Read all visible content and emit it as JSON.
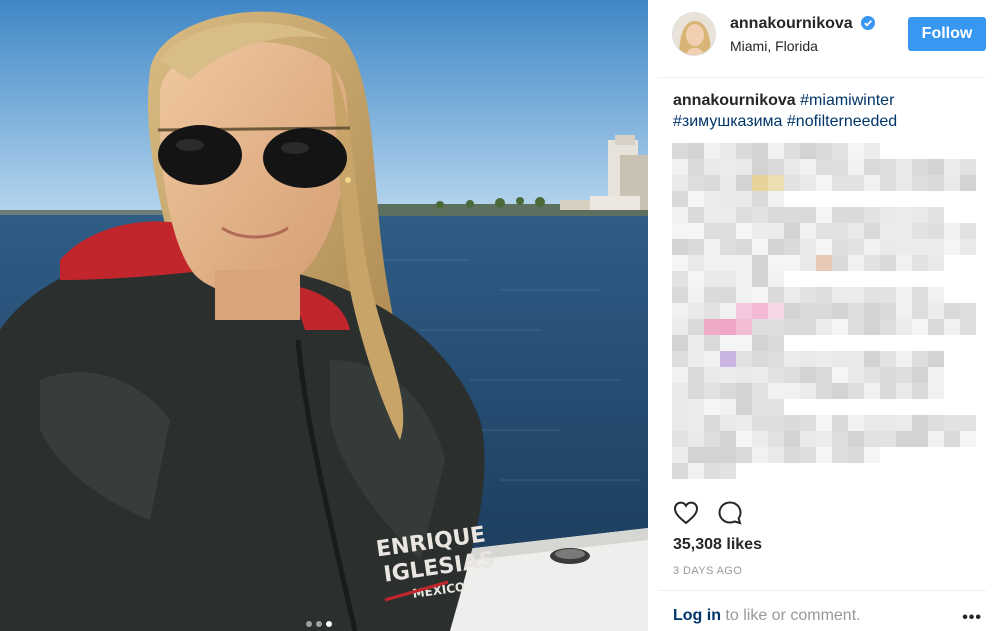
{
  "post": {
    "author": {
      "username": "annakournikova",
      "location": "Miami, Florida",
      "verified": true
    },
    "follow_label": "Follow",
    "caption": {
      "username": "annakournikova",
      "hashtags": [
        "#miamiwinter",
        "#зимушказима",
        "#nofilterneeded"
      ]
    },
    "likes_text": "35,308 likes",
    "time_text": "3 DAYS AGO",
    "login_text": "Log in",
    "login_suffix": " to like or comment.",
    "more_glyph": "•••",
    "jacket_text": [
      "ENRIQUE",
      "IGLESIAS",
      "MEXICO"
    ]
  },
  "carousel": {
    "count": 3,
    "active_index": 2
  },
  "colors": {
    "accent": "#3897f0",
    "hashtag": "#003569",
    "muted": "#999999",
    "text": "#262626"
  },
  "icons": {
    "verified": "verified-badge-icon",
    "like": "heart-outline-icon",
    "comment": "comment-bubble-icon",
    "more": "more-options-icon"
  }
}
